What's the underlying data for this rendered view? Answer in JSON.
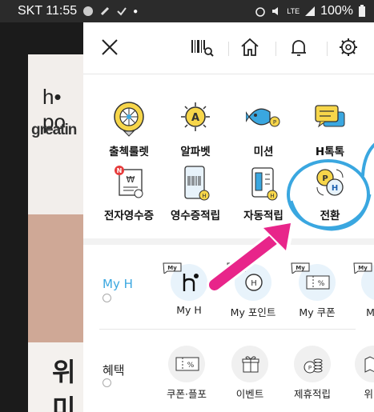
{
  "status_bar": {
    "carrier_time": "SKT 11:55",
    "battery": "100%",
    "lte": "LTE"
  },
  "background": {
    "logo_top": "h• po",
    "logo_bottom": "greatin",
    "big_text": "위미"
  },
  "toolbar": {
    "close": "close-icon",
    "barcode": "barcode-scan-icon",
    "home": "home-icon",
    "bell": "bell-icon",
    "settings": "gear-icon"
  },
  "grid": [
    {
      "label": "출첵룰렛",
      "icon": "roulette-icon"
    },
    {
      "label": "알파벳",
      "icon": "alphabet-sun-icon"
    },
    {
      "label": "미션",
      "icon": "fish-mission-icon"
    },
    {
      "label": "H톡톡",
      "icon": "chat-bubbles-icon"
    },
    {
      "label": "전자영수증",
      "icon": "e-receipt-icon"
    },
    {
      "label": "영수증적립",
      "icon": "receipt-scan-icon"
    },
    {
      "label": "자동적립",
      "icon": "auto-earn-card-icon"
    },
    {
      "label": "전환",
      "icon": "point-convert-icon"
    }
  ],
  "my_h": {
    "label": "My H",
    "items": [
      {
        "label": "My H",
        "badge": "My"
      },
      {
        "label": "My 포인트",
        "badge": "My"
      },
      {
        "label": "My 쿠폰",
        "badge": "My"
      },
      {
        "label": "My 영",
        "badge": "My"
      }
    ]
  },
  "benefits": {
    "label": "혜택",
    "items": [
      {
        "label": "쿠폰·플포"
      },
      {
        "label": "이벤트"
      },
      {
        "label": "제휴적립"
      },
      {
        "label": "위치"
      }
    ]
  },
  "colors": {
    "accent_blue": "#3aa7e0",
    "highlight_pink": "#e8258a",
    "yellow": "#f7d64a"
  }
}
